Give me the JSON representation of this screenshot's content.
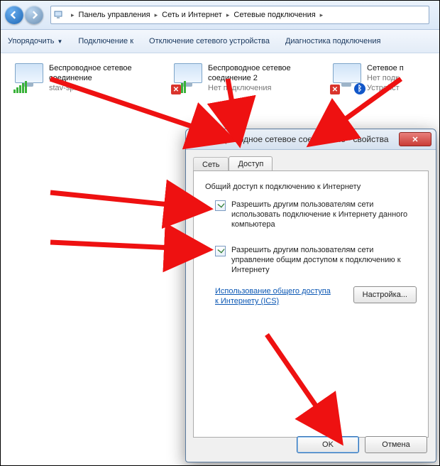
{
  "breadcrumb": {
    "root_icon": "computer",
    "items": [
      "Панель управления",
      "Сеть и Интернет",
      "Сетевые подключения"
    ]
  },
  "toolbar": {
    "organize": "Упорядочить",
    "connect": "Подключение к",
    "disable": "Отключение сетевого устройства",
    "diagnose": "Диагностика подключения"
  },
  "connections": [
    {
      "title1": "Беспроводное сетевое",
      "title2": "соединение",
      "sub": "stav-spb",
      "state": "ok"
    },
    {
      "title1": "Беспроводное сетевое",
      "title2": "соединение 2",
      "sub": "Нет подключения",
      "state": "x"
    },
    {
      "title1": "Сетевое п",
      "title2": "Нет подк",
      "sub": "Устройст",
      "state": "bt"
    }
  ],
  "dialog": {
    "title": "Беспроводное сетевое соединение - свойства",
    "tabs": {
      "network": "Сеть",
      "sharing": "Доступ"
    },
    "group": "Общий доступ к подключению к Интернету",
    "check1": "Разрешить другим пользователям сети использовать подключение к Интернету данного компьютера",
    "check2": "Разрешить другим пользователям сети управление общим доступом к подключению к Интернету",
    "link": "Использование общего доступа к Интернету (ICS)",
    "settings_btn": "Настройка...",
    "ok": "OK",
    "cancel": "Отмена"
  }
}
